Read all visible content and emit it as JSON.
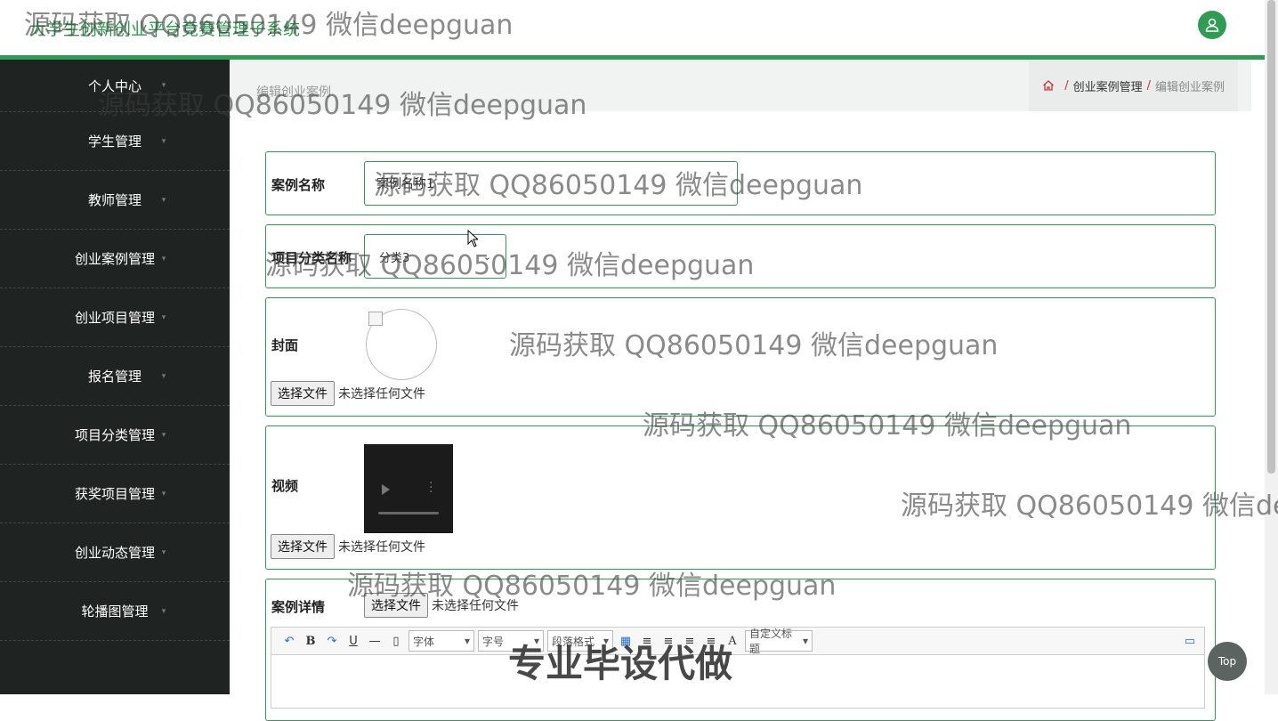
{
  "header": {
    "title": "大学生创新创业平台竞赛管理子系统",
    "avatar_icon": "user-icon"
  },
  "sidebar": {
    "items": [
      {
        "label": "个人中心"
      },
      {
        "label": "学生管理"
      },
      {
        "label": "教师管理"
      },
      {
        "label": "创业案例管理"
      },
      {
        "label": "创业项目管理"
      },
      {
        "label": "报名管理"
      },
      {
        "label": "项目分类管理"
      },
      {
        "label": "获奖项目管理"
      },
      {
        "label": "创业动态管理"
      },
      {
        "label": "轮播图管理"
      }
    ]
  },
  "page": {
    "title": "编辑创业案例",
    "breadcrumb": {
      "home_icon": "home-icon",
      "sep": "/",
      "level1": "创业案例管理",
      "level2": "编辑创业案例"
    }
  },
  "form": {
    "case_name": {
      "label": "案例名称",
      "value": "案例名称1"
    },
    "category": {
      "label": "项目分类名称",
      "value": "分类3"
    },
    "cover": {
      "label": "封面",
      "button": "选择文件",
      "status": "未选择任何文件"
    },
    "video": {
      "label": "视频",
      "button": "选择文件",
      "status": "未选择任何文件"
    },
    "detail": {
      "label": "案例详情",
      "button": "选择文件",
      "status": "未选择任何文件",
      "toolbar": {
        "font": "字体",
        "size": "字号",
        "paragraph": "段落格式",
        "custom_title": "自定义标题"
      }
    }
  },
  "top_button": "Top",
  "watermarks": {
    "text": "源码获取 QQ86050149 微信deepguan",
    "text_cut": "源码获取 QQ86050149 微信de",
    "big": "专业毕设代做"
  }
}
